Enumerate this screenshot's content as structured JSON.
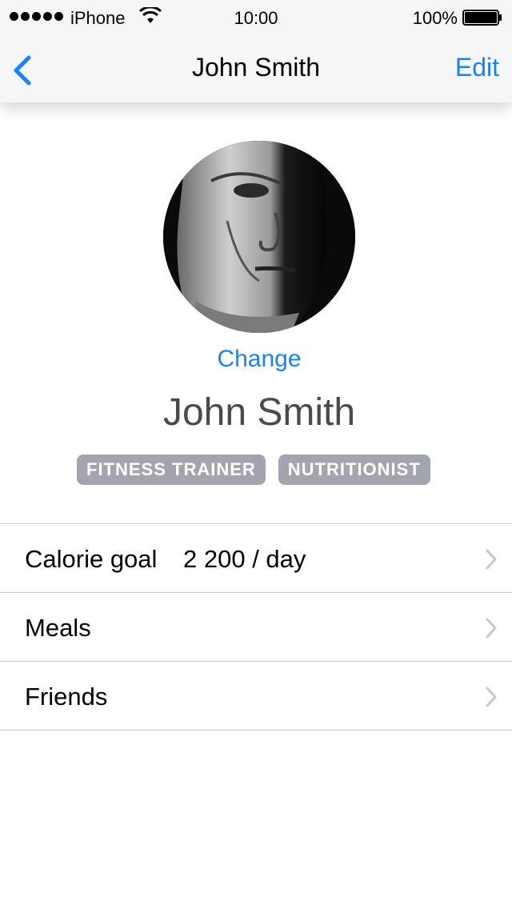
{
  "status_bar": {
    "carrier": "iPhone",
    "time": "10:00",
    "battery": "100%"
  },
  "nav": {
    "title": "John Smith",
    "edit_label": "Edit"
  },
  "profile": {
    "change_label": "Change",
    "name": "John Smith",
    "tags": [
      "FITNESS TRAINER",
      "NUTRITIONIST"
    ]
  },
  "list": {
    "items": [
      {
        "label": "Calorie goal",
        "value": "2 200 / day"
      },
      {
        "label": "Meals",
        "value": ""
      },
      {
        "label": "Friends",
        "value": ""
      }
    ]
  },
  "colors": {
    "accent": "#1a82f7",
    "tag_bg": "#a2a5ad",
    "separator": "#c8c7cc"
  },
  "icons": {
    "back": "chevron-left-icon",
    "row": "chevron-right-icon",
    "wifi": "wifi-icon",
    "battery": "battery-icon",
    "signal": "signal-dots-icon"
  }
}
